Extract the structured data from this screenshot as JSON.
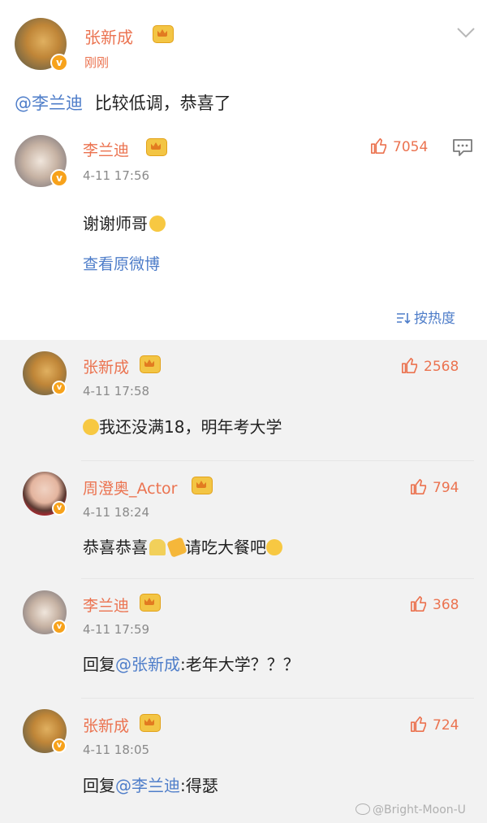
{
  "post": {
    "author": "张新成",
    "time": "刚刚",
    "mention": "@李兰迪",
    "text": "比较低调，恭喜了"
  },
  "quoted": {
    "author": "李兰迪",
    "time": "4-11 17:56",
    "text": "谢谢师哥",
    "likes": "7054",
    "view_original": "查看原微博"
  },
  "sort": {
    "label": "按热度"
  },
  "comments": [
    {
      "author": "张新成",
      "time": "4-11 17:58",
      "text": "我还没满18，明年考大学",
      "likes": "2568"
    },
    {
      "author": "周澄奥_Actor",
      "time": "4-11 18:24",
      "text": "恭喜恭喜",
      "text_tail": "请吃大餐吧",
      "likes": "794"
    },
    {
      "author": "李兰迪",
      "time": "4-11 17:59",
      "reply_prefix": "回复",
      "mention": "@张新成",
      "text": ":老年大学？？？",
      "likes": "368"
    },
    {
      "author": "张新成",
      "time": "4-11 18:05",
      "reply_prefix": "回复",
      "mention": "@李兰迪",
      "text": ":得瑟",
      "likes": "724"
    }
  ],
  "watermark": "@Bright-Moon-U",
  "colors": {
    "name": "#eb7350",
    "link": "#4e7dc9",
    "time": "#8a8a8a",
    "comments_bg": "#f2f2f2"
  }
}
